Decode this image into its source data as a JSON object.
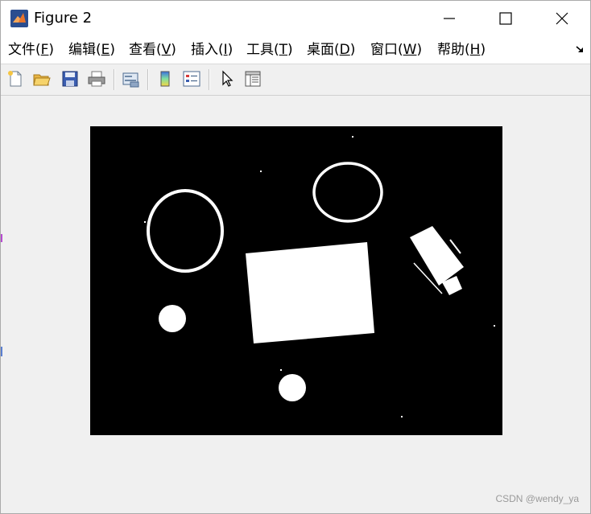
{
  "window": {
    "title": "Figure 2"
  },
  "menu": {
    "items": [
      {
        "label": "文件(",
        "key": "F",
        "tail": ")"
      },
      {
        "label": "编辑(",
        "key": "E",
        "tail": ")"
      },
      {
        "label": "查看(",
        "key": "V",
        "tail": ")"
      },
      {
        "label": "插入(",
        "key": "I",
        "tail": ")"
      },
      {
        "label": "工具(",
        "key": "T",
        "tail": ")"
      },
      {
        "label": "桌面(",
        "key": "D",
        "tail": ")"
      },
      {
        "label": "窗口(",
        "key": "W",
        "tail": ")"
      },
      {
        "label": "帮助(",
        "key": "H",
        "tail": ")"
      }
    ]
  },
  "toolbar": {
    "buttons": [
      {
        "icon": "new-figure-icon"
      },
      {
        "icon": "open-file-icon"
      },
      {
        "icon": "save-icon"
      },
      {
        "icon": "print-icon"
      },
      {
        "icon": "link-plot-icon"
      },
      {
        "icon": "colorbar-icon"
      },
      {
        "icon": "legend-icon"
      },
      {
        "icon": "pointer-icon"
      },
      {
        "icon": "property-inspector-icon"
      }
    ]
  },
  "figure": {
    "image_description_colors": {
      "background": "#000000",
      "foreground": "#ffffff"
    }
  },
  "watermark": {
    "text": "CSDN @wendy_ya"
  }
}
